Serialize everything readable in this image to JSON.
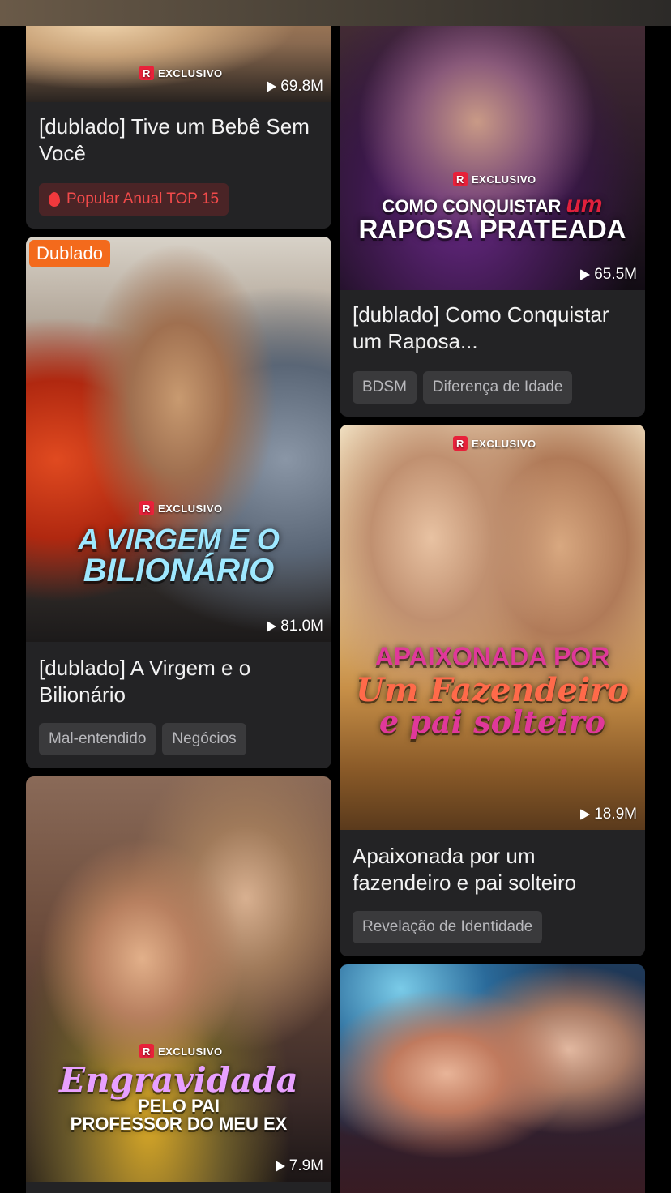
{
  "cards": [
    {
      "title": "[dublado] Tive um Bebê Sem Você",
      "views": "69.8M",
      "exclusive": "EXCLUSIVO",
      "tags": [
        "Popular Anual TOP 15"
      ]
    },
    {
      "title": "[dublado] Como Conquistar um Raposa...",
      "views": "65.5M",
      "exclusive": "EXCLUSIVO",
      "poster_title_line1": "COMO CONQUISTAR",
      "poster_title_accent": "um",
      "poster_title_line2": "RAPOSA PRATEADA",
      "tags": [
        "BDSM",
        "Diferença de Idade"
      ]
    },
    {
      "badge": "Dublado",
      "title": "[dublado] A Virgem e o Bilionário",
      "views": "81.0M",
      "exclusive": "EXCLUSIVO",
      "poster_title_line1": "A VIRGEM E O",
      "poster_title_line2": "BILIONÁRIO",
      "tags": [
        "Mal-entendido",
        "Negócios"
      ]
    },
    {
      "title": "Apaixonada por um fazendeiro e pai solteiro",
      "views": "18.9M",
      "exclusive": "EXCLUSIVO",
      "poster_title_line1": "APAIXONADA POR",
      "poster_title_line2": "Um Fazendeiro",
      "poster_title_line3": "e pai solteiro",
      "tags": [
        "Revelação de Identidade"
      ]
    },
    {
      "views": "7.9M",
      "exclusive": "EXCLUSIVO",
      "poster_title_line1": "Engravidada",
      "poster_title_line2": "PELO PAI",
      "poster_title_line3": "PROFESSOR DO MEU EX"
    },
    {}
  ],
  "colors": {
    "background": "#000000",
    "card": "#232325",
    "tag": "#3a3a3c",
    "tag_text": "#b8b8bc",
    "hot_tag_text": "#f24a4a",
    "dub_badge": "#f36a1c",
    "exclusive_red": "#e8213a"
  },
  "icons": [
    "play-icon",
    "flame-icon",
    "r-logo-icon"
  ]
}
